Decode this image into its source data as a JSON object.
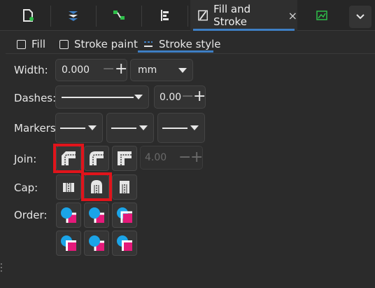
{
  "dock": {
    "tabs": [
      {
        "icon": "document-properties-icon"
      },
      {
        "icon": "layers-icon"
      },
      {
        "icon": "xml-editor-icon"
      },
      {
        "icon": "align-distribute-icon"
      }
    ],
    "active_tab": {
      "icon": "fill-stroke-icon",
      "title": "Fill and Stroke",
      "close": "×"
    },
    "extra_tab": {
      "icon": "export-icon"
    },
    "more": {
      "icon": "chevron-down-icon"
    },
    "colors": {
      "accent": "#3e7fc4",
      "icon_green": "#2fbf4a"
    }
  },
  "subtabs": [
    {
      "label": "Fill",
      "icon": "checkbox-icon"
    },
    {
      "label": "Stroke paint",
      "icon": "checkbox-icon"
    },
    {
      "label": "Stroke style",
      "icon": "stroke-style-icon",
      "active": true
    }
  ],
  "width": {
    "label": "Width:",
    "value": "0.000",
    "unit": "mm"
  },
  "dashes": {
    "label": "Dashes:",
    "offset": "0.00"
  },
  "markers": {
    "label": "Markers:"
  },
  "join": {
    "label": "Join:",
    "miter_limit": "4.00",
    "selected": "bevel"
  },
  "cap": {
    "label": "Cap:",
    "selected": "round"
  },
  "order": {
    "label": "Order:"
  },
  "highlight_color": "#e0141b"
}
